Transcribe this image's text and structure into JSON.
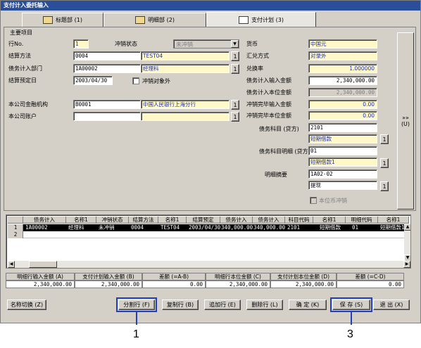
{
  "window": {
    "title": "支付计入委托输入"
  },
  "tabs": [
    {
      "label": "标题部 (1)"
    },
    {
      "label": "明细部 (2)"
    },
    {
      "label": "支付计划 (3)"
    }
  ],
  "main_group": {
    "legend": "主要项目"
  },
  "form_left": {
    "row_no_label": "行No.",
    "row_no_value": "1",
    "offset_status_label": "冲销状态",
    "offset_status_value": "未冲销",
    "settle_method_label": "结算方法",
    "settle_method_code": "0004",
    "settle_method_name": "TEST04",
    "debt_dept_label": "债务计入部门",
    "debt_dept_code": "1A00002",
    "debt_dept_name": "经理科",
    "settle_date_label": "结算预定日",
    "settle_date_value": "2003/04/30",
    "offset_target_label": "冲销对象外",
    "fin_org_label": "本公司金融机构",
    "fin_org_code": "B0001",
    "fin_org_name": "中国人民银行上海分行",
    "account_label": "本公司账户",
    "account_code": "",
    "account_name": ""
  },
  "form_right": {
    "currency_label": "货币",
    "currency_value": "中国元",
    "rate_method_label": "汇兑方式",
    "rate_method_value": "对录外",
    "rate_label": "兑换率",
    "rate_value": "1.000000",
    "debt_input_amt_label": "债务计入输入金额",
    "debt_input_amt_value": "2,340,000.00",
    "debt_base_amt_label": "债务计入本位金额",
    "debt_base_amt_value": "2,340,000.00",
    "offset_input_amt_label": "冲销完毕输入金额",
    "offset_input_amt_value": "0.00",
    "offset_base_amt_label": "冲销完毕本位金额",
    "offset_base_amt_value": "0.00",
    "debt_subject_label": "债务科目 (贷方)",
    "debt_subject_code": "2101",
    "debt_subject_name": "短期借款",
    "debt_detail_label": "债务科目明细 (贷方)",
    "debt_detail_code": "01",
    "debt_detail_name": "短期借款1",
    "summary_label": "明细摘要",
    "summary_code": "1A02-02",
    "summary_name": "提现",
    "base_offset_label": "本位币冲销"
  },
  "lookup_button": "1",
  "side_button": {
    "arrows": "»»",
    "key": "(U)"
  },
  "grid": {
    "headers": [
      "",
      "债务计入",
      "名称1",
      "冲销状态",
      "结算方法",
      "名称1",
      "结算预定",
      "债务计入",
      "债务计入",
      "科目代码",
      "名称1",
      "明细代码",
      "名称1"
    ],
    "rows": [
      {
        "no": "1",
        "cells": [
          "1A00002",
          "经理科",
          "未冲销",
          "0004",
          "TEST04",
          "2003/04/30",
          "340,000.00",
          "340,000.00",
          "2101",
          "短期借款",
          "01",
          "短期借款1"
        ]
      },
      {
        "no": "2",
        "cells": [
          "",
          "",
          "",
          "",
          "",
          "",
          "",
          "",
          "",
          "",
          "",
          ""
        ]
      }
    ]
  },
  "summary": {
    "headers": [
      "明细行输入金额 (A)",
      "支付计划输入金额 (B)",
      "差额 (=A-B)",
      "明细行本位金额 (C)",
      "支付计划本位金额 (D)",
      "差额 (=C-D)"
    ],
    "values": [
      "2,340,000.00",
      "2,340,000.00",
      "0.00",
      "2,340,000.00",
      "2,340,000.00",
      "0.00"
    ]
  },
  "buttons": {
    "name_switch": "名称切换 (Z)",
    "split_row": "分割行 (F)",
    "copy_row": "复制行 (B)",
    "add_row": "追加行 (E)",
    "delete_row": "删除行 (L)",
    "confirm": "确  定 (K)",
    "save": "保  存 (S)",
    "exit": "退  出 (X)"
  },
  "callouts": [
    "1",
    "3"
  ],
  "colors": {
    "title_bar": "#2a4e9a",
    "highlight": "#2040c0",
    "required_field": "#fff8c8"
  }
}
